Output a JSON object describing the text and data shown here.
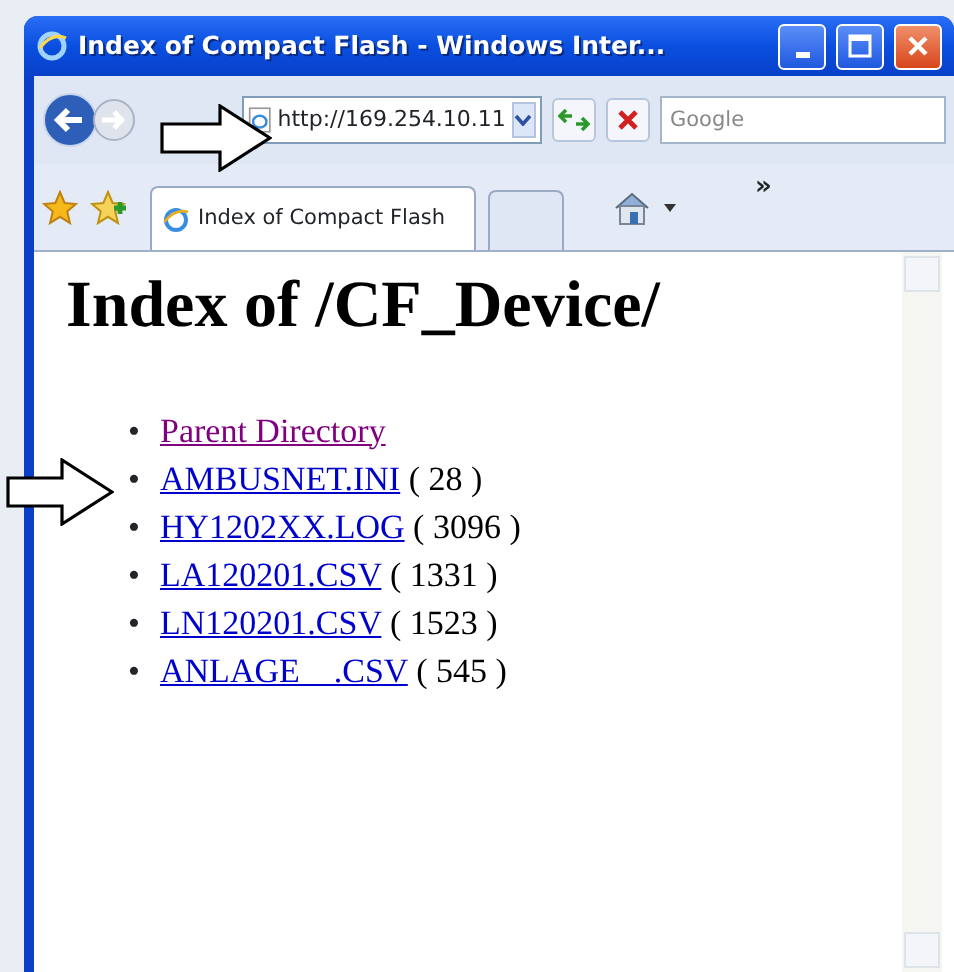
{
  "window": {
    "title": "Index of Compact Flash - Windows Inter..."
  },
  "toolbar": {
    "address": "http://169.254.10.11",
    "search_placeholder": "Google",
    "chevron": "»"
  },
  "tabs": [
    {
      "label": "Index of Compact Flash",
      "selected": true
    }
  ],
  "page": {
    "heading": "Index of /CF_Device/",
    "entries": [
      {
        "marker": "•",
        "name": "Parent Directory",
        "visited": true
      },
      {
        "marker": "•",
        "name": "AMBUSNET.INI",
        "size": "( 28 )",
        "visited": false
      },
      {
        "marker": "•",
        "name": "HY1202XX.LOG",
        "size": "( 3096 )",
        "visited": false
      },
      {
        "marker": "•",
        "name": "LA120201.CSV",
        "size": "( 1331 )",
        "visited": false
      },
      {
        "marker": "•",
        "name": "LN120201.CSV",
        "size": "( 1523 )",
        "visited": false
      },
      {
        "marker": "•",
        "name": "ANLAGE    .CSV",
        "size": "( 545 )",
        "visited": false
      }
    ]
  }
}
